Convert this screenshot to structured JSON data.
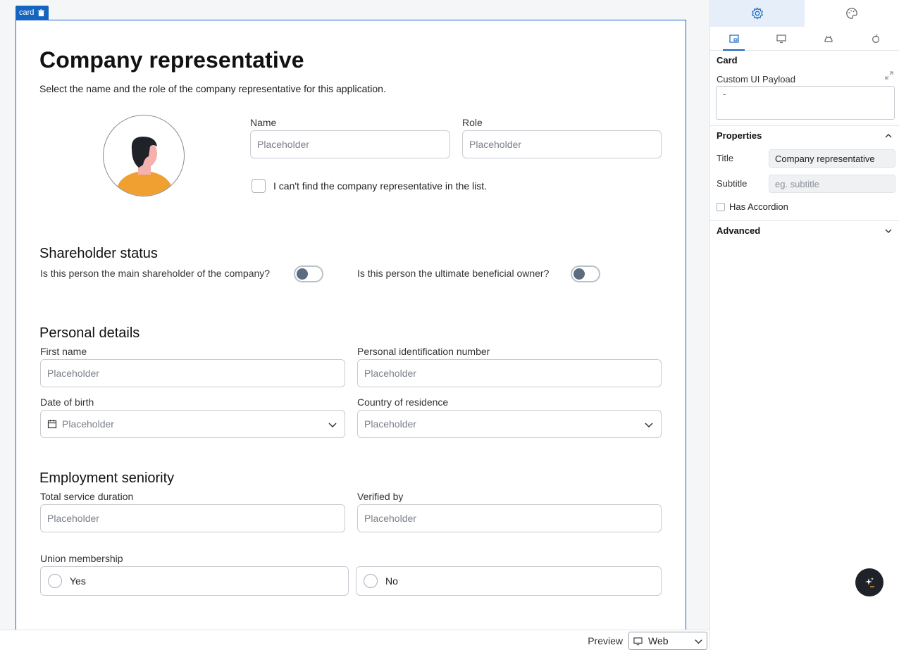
{
  "card_tag": {
    "label": "card",
    "icon": "trash-icon"
  },
  "card": {
    "title": "Company representative",
    "subtitle": "Select the name and the role of the company representative for this application.",
    "name": {
      "label": "Name",
      "placeholder": "Placeholder"
    },
    "role": {
      "label": "Role",
      "placeholder": "Placeholder"
    },
    "not_found_checkbox": {
      "label": "I can't find the company representative in the list.",
      "checked": false
    }
  },
  "shareholder": {
    "heading": "Shareholder status",
    "main_shareholder": {
      "label": "Is this person the main shareholder of the company?",
      "on": false
    },
    "beneficial_owner": {
      "label": "Is this person the ultimate beneficial owner?",
      "on": false
    }
  },
  "personal": {
    "heading": "Personal details",
    "first_name": {
      "label": "First name",
      "placeholder": "Placeholder"
    },
    "pin": {
      "label": "Personal identification number",
      "placeholder": "Placeholder"
    },
    "dob": {
      "label": "Date of birth",
      "placeholder": "Placeholder"
    },
    "country": {
      "label": "Country of residence",
      "placeholder": "Placeholder"
    }
  },
  "employment": {
    "heading": "Employment seniority",
    "duration": {
      "label": "Total service duration",
      "placeholder": "Placeholder"
    },
    "verified": {
      "label": "Verified by",
      "placeholder": "Placeholder"
    },
    "union": {
      "label": "Union membership",
      "options": [
        "Yes",
        "No"
      ]
    }
  },
  "bottom": {
    "preview_label": "Preview",
    "platform": "Web"
  },
  "panel": {
    "card_heading": "Card",
    "payload_label": "Custom UI Payload",
    "payload_value": "-",
    "properties_heading": "Properties",
    "title_label": "Title",
    "title_value": "Company representative",
    "subtitle_label": "Subtitle",
    "subtitle_placeholder": "eg. subtitle",
    "accordion_label": "Has Accordion",
    "advanced_heading": "Advanced"
  },
  "colors": {
    "accent": "#1565c0",
    "toggle_knob": "#5b6b80",
    "avatar_shirt": "#f0a030"
  }
}
